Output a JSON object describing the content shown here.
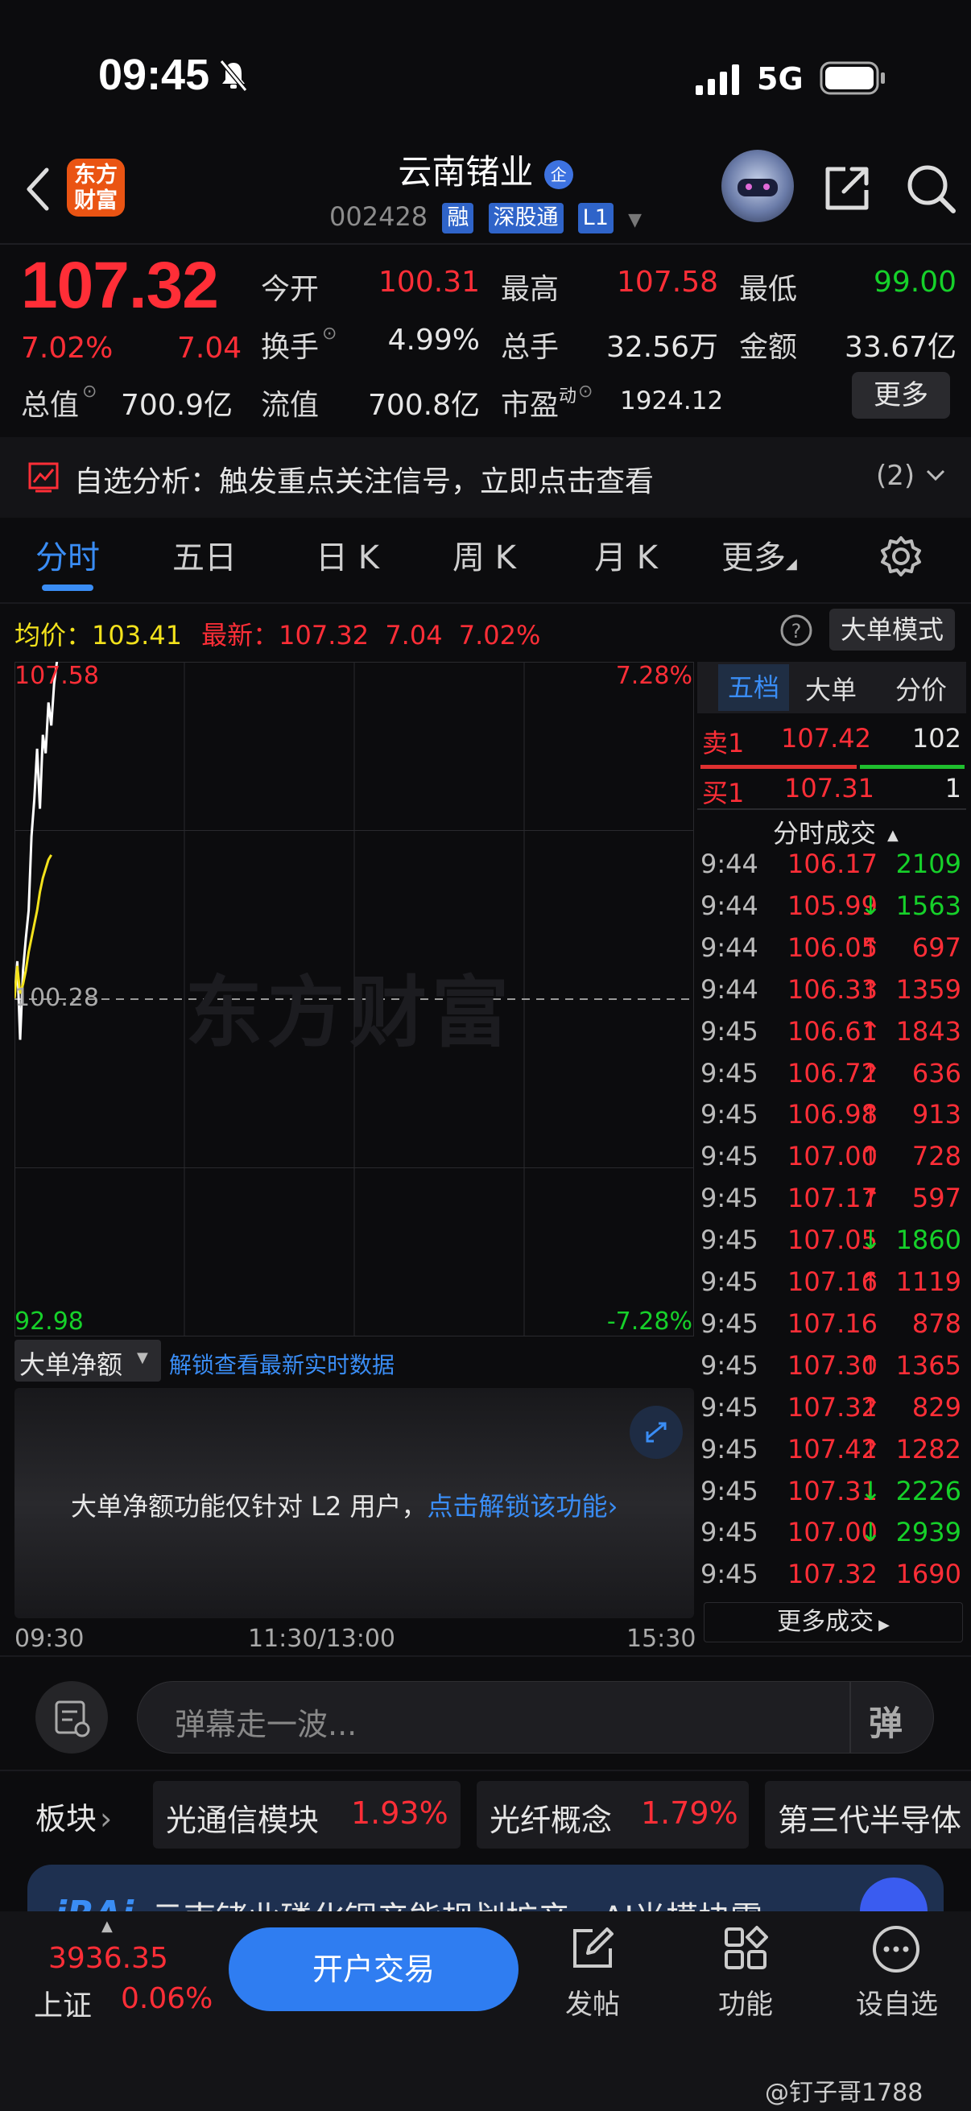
{
  "status_bar": {
    "time": "09:45",
    "network": "5G"
  },
  "header": {
    "back_icon": "chevron-left-icon",
    "logo_line1": "东方",
    "logo_line2": "财富",
    "stock_name": "云南锗业",
    "badge": "企",
    "code": "002428",
    "tags": [
      "融",
      "深股通",
      "L1"
    ]
  },
  "quote": {
    "price": "107.32",
    "change_pct": "7.02%",
    "change": "7.04",
    "open_label": "今开",
    "open": "100.31",
    "high_label": "最高",
    "high": "107.58",
    "low_label": "最低",
    "low": "99.00",
    "turnover_label": "换手",
    "turnover": "4.99%",
    "volume_label": "总手",
    "volume": "32.56万",
    "amount_label": "金额",
    "amount": "33.67亿",
    "mktcap_label": "总值",
    "mktcap": "700.9亿",
    "float_label": "流值",
    "float_cap": "700.8亿",
    "pe_label": "市盈",
    "pe_sup": "动",
    "pe": "1924.12",
    "more_button": "更多"
  },
  "alert": {
    "text": "自选分析：触发重点关注信号，立即点击查看",
    "count": "(2)"
  },
  "tabs": [
    "分时",
    "五日",
    "日 K",
    "周 K",
    "月 K",
    "更多"
  ],
  "chart_header": {
    "avg_label": "均价：",
    "avg": "103.41",
    "latest_label": "最新：",
    "latest": "107.32",
    "latest_change": "7.04",
    "latest_pct": "7.02%",
    "mode_button": "大单模式"
  },
  "chart_data": {
    "type": "line",
    "y_top_label": "107.58",
    "y_mid_label": "100.28",
    "y_bottom_label": "92.98",
    "pct_top_label": "7.28%",
    "pct_bottom_label": "-7.28%",
    "x_labels": [
      "09:30",
      "11:30/13:00",
      "15:30"
    ],
    "ylim": [
      92.98,
      107.58
    ],
    "watermark": "东方财富",
    "series": [
      {
        "color": "#ffffff",
        "values": [
          100.3,
          101.1,
          99.4,
          100.9,
          101.6,
          102.2,
          103.8,
          104.6,
          105.7,
          104.4,
          106.0,
          105.6,
          106.7,
          106.2,
          107.1,
          107.6
        ]
      },
      {
        "color": "#f3e21c",
        "values": [
          100.3,
          101.0,
          100.4,
          100.6,
          100.9,
          101.3,
          101.6,
          101.9,
          102.2,
          102.6,
          102.9,
          103.1,
          103.3,
          103.4
        ]
      }
    ]
  },
  "order_book": {
    "tabs": [
      "五档",
      "大单",
      "分价"
    ],
    "sell": {
      "label": "卖1",
      "price": "107.42",
      "qty": "102"
    },
    "buy": {
      "label": "买1",
      "price": "107.31",
      "qty": "1"
    },
    "trades_title": "分时成交",
    "trades": [
      {
        "t": "9:44",
        "p": "106.17",
        "a": "",
        "v": "2109",
        "c": "green"
      },
      {
        "t": "9:44",
        "p": "105.99",
        "a": "↓",
        "v": "1563",
        "c": "green"
      },
      {
        "t": "9:44",
        "p": "106.05",
        "a": "↑",
        "v": "697",
        "c": "red"
      },
      {
        "t": "9:44",
        "p": "106.33",
        "a": "↑",
        "v": "1359",
        "c": "red"
      },
      {
        "t": "9:45",
        "p": "106.61",
        "a": "↑",
        "v": "1843",
        "c": "red"
      },
      {
        "t": "9:45",
        "p": "106.72",
        "a": "↑",
        "v": "636",
        "c": "red"
      },
      {
        "t": "9:45",
        "p": "106.98",
        "a": "↑",
        "v": "913",
        "c": "red"
      },
      {
        "t": "9:45",
        "p": "107.00",
        "a": "↑",
        "v": "728",
        "c": "red"
      },
      {
        "t": "9:45",
        "p": "107.17",
        "a": "↑",
        "v": "597",
        "c": "red"
      },
      {
        "t": "9:45",
        "p": "107.05",
        "a": "↓",
        "v": "1860",
        "c": "green"
      },
      {
        "t": "9:45",
        "p": "107.16",
        "a": "↑",
        "v": "1119",
        "c": "red"
      },
      {
        "t": "9:45",
        "p": "107.16",
        "a": "",
        "v": "878",
        "c": "red"
      },
      {
        "t": "9:45",
        "p": "107.30",
        "a": "↑",
        "v": "1365",
        "c": "red"
      },
      {
        "t": "9:45",
        "p": "107.32",
        "a": "↑",
        "v": "829",
        "c": "red"
      },
      {
        "t": "9:45",
        "p": "107.42",
        "a": "↑",
        "v": "1282",
        "c": "red"
      },
      {
        "t": "9:45",
        "p": "107.31",
        "a": "↓",
        "v": "2226",
        "c": "green"
      },
      {
        "t": "9:45",
        "p": "107.00",
        "a": "↓",
        "v": "2939",
        "c": "green"
      },
      {
        "t": "9:45",
        "p": "107.32",
        "a": "",
        "v": "1690",
        "c": "red"
      }
    ],
    "more_trades": "更多成交"
  },
  "big_order": {
    "select_label": "大单净额",
    "unlock_link": "解锁查看最新实时数据",
    "notice": "大单净额功能仅针对 L2 用户，",
    "notice_link": "点击解锁该功能"
  },
  "comment": {
    "placeholder": "弹幕走一波...",
    "danmu": "弹"
  },
  "sectors": {
    "label": "板块",
    "items": [
      {
        "name": "光通信模块",
        "pct": "1.93%"
      },
      {
        "name": "光纤概念",
        "pct": "1.79%"
      },
      {
        "name": "第三代半导体",
        "pct": ""
      }
    ]
  },
  "banner": {
    "text": "云南锗业磷化铟产能规划扩产，AI光模块需"
  },
  "bottom": {
    "index_value": "3936.35",
    "index_name": "上证",
    "index_pct": "0.06%",
    "trade_button": "开户交易",
    "post_label": "发帖",
    "func_label": "功能",
    "watch_label": "设自选"
  },
  "watermark_user": "@钉子哥1788"
}
